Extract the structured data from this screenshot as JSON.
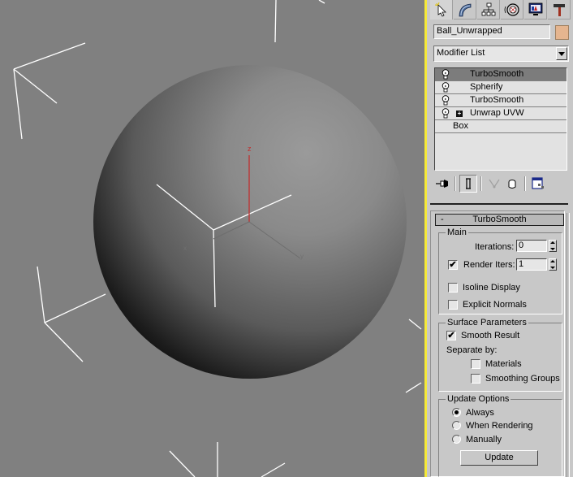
{
  "viewport": {
    "background": "#808080",
    "border_color": "#f5e93a",
    "axis_labels": {
      "z": "z",
      "x": "x",
      "y": "y"
    },
    "z_axis_color": "#c03030"
  },
  "command_panel": {
    "tabs": [
      {
        "name": "create",
        "icon": "create-arrow-icon",
        "active": true
      },
      {
        "name": "modify",
        "icon": "modify-arc-icon",
        "active": false
      },
      {
        "name": "hierarchy",
        "icon": "hierarchy-icon",
        "active": false
      },
      {
        "name": "motion",
        "icon": "motion-wheel-icon",
        "active": false
      },
      {
        "name": "display",
        "icon": "display-monitor-icon",
        "active": false
      },
      {
        "name": "utilities",
        "icon": "utilities-hammer-icon",
        "active": false
      }
    ],
    "object_name": "Ball_Unwrapped",
    "object_color": "#e5b58f",
    "modifier_list_label": "Modifier List",
    "stack": [
      {
        "label": "TurboSmooth",
        "selected": true,
        "has_bulb": true,
        "expandable": false
      },
      {
        "label": "Spherify",
        "selected": false,
        "has_bulb": true,
        "expandable": false
      },
      {
        "label": "TurboSmooth",
        "selected": false,
        "has_bulb": true,
        "expandable": false
      },
      {
        "label": "Unwrap UVW",
        "selected": false,
        "has_bulb": true,
        "expandable": true
      },
      {
        "label": "Box",
        "selected": false,
        "has_bulb": false,
        "expandable": false
      }
    ],
    "stack_toolbar": [
      "pin-stack-icon",
      "show-end-result-icon",
      "make-unique-icon",
      "remove-modifier-icon",
      "configure-modifier-sets-icon"
    ]
  },
  "rollout": {
    "title": "TurboSmooth",
    "collapse_symbol": "-",
    "main": {
      "title": "Main",
      "iterations_label": "Iterations:",
      "iterations_value": "0",
      "render_iters_label": "Render Iters:",
      "render_iters_value": "1",
      "render_iters_checked": true,
      "isoline_label": "Isoline Display",
      "isoline_checked": false,
      "explicit_normals_label": "Explicit Normals",
      "explicit_normals_checked": false
    },
    "surface": {
      "title": "Surface Parameters",
      "smooth_result_label": "Smooth Result",
      "smooth_result_checked": true,
      "separate_by_label": "Separate by:",
      "materials_label": "Materials",
      "materials_checked": false,
      "smoothing_groups_label": "Smoothing Groups",
      "smoothing_groups_checked": false
    },
    "update": {
      "title": "Update Options",
      "options": [
        "Always",
        "When Rendering",
        "Manually"
      ],
      "selected": "Always",
      "update_button": "Update"
    }
  }
}
